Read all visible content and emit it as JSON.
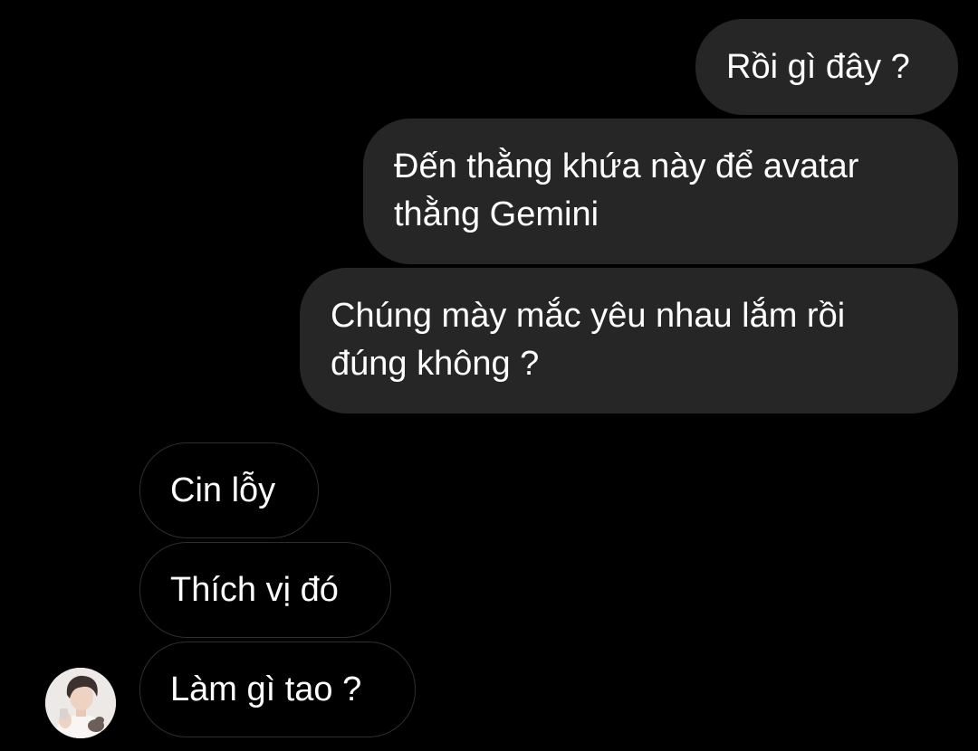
{
  "messages": [
    {
      "direction": "outgoing",
      "text": "Rồi gì đây ?"
    },
    {
      "direction": "outgoing",
      "text": "Đến thằng khứa này để avatar thằng Gemini"
    },
    {
      "direction": "outgoing",
      "text": "Chúng mày mắc yêu nhau lắm rồi đúng không ?"
    },
    {
      "direction": "incoming",
      "text": "Cin lỗy"
    },
    {
      "direction": "incoming",
      "text": "Thích vị đó"
    },
    {
      "direction": "incoming",
      "text": "Làm gì tao ?"
    }
  ],
  "colors": {
    "background": "#000000",
    "outgoing_bubble": "#262626",
    "incoming_border": "#2e2e2e",
    "text": "#ffffff"
  },
  "icons": {
    "sender_avatar": "avatar"
  }
}
